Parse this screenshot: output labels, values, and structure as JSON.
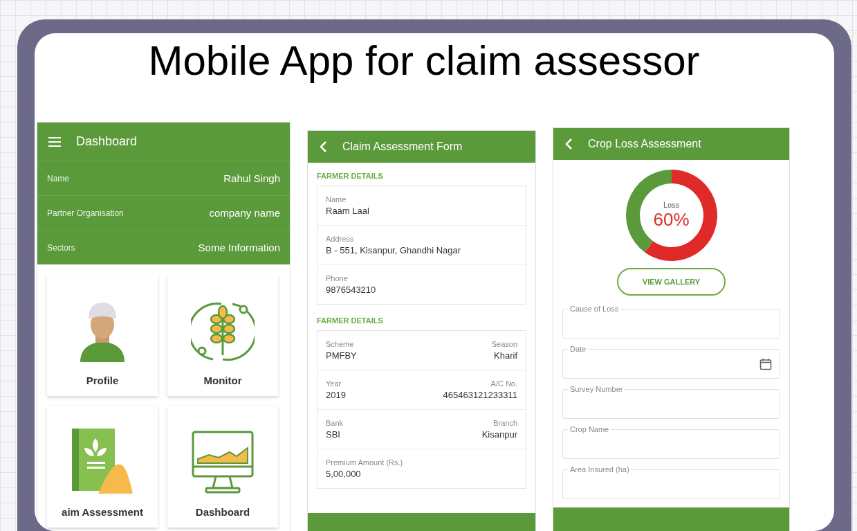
{
  "slide": {
    "title": "Mobile App for claim assessor"
  },
  "screens": [
    {
      "kind": "dashboard",
      "header": {
        "title": "Dashboard"
      },
      "info": [
        {
          "label": "Name",
          "value": "Rahul Singh"
        },
        {
          "label": "Partner Organisation",
          "value": "company  name"
        },
        {
          "label": "Sectors",
          "value": "Some Information"
        }
      ],
      "tiles": [
        {
          "kind": "profile",
          "label": "Profile"
        },
        {
          "kind": "monitor",
          "label": "Monitor"
        },
        {
          "kind": "claim",
          "label": "aim Assessment"
        },
        {
          "kind": "dashboard",
          "label": "Dashboard"
        }
      ]
    },
    {
      "kind": "claim_form",
      "header": {
        "title": "Claim Assessment Form"
      },
      "sections": [
        {
          "title": "FARMER DETAILS",
          "rows": [
            {
              "fields": [
                {
                  "label": "Name",
                  "value": "Raam Laal"
                }
              ]
            },
            {
              "fields": [
                {
                  "label": "Address",
                  "value": "B - 551, Kisanpur, Ghandhi Nagar"
                }
              ]
            },
            {
              "fields": [
                {
                  "label": "Phone",
                  "value": "9876543210"
                }
              ]
            }
          ]
        },
        {
          "title": "FARMER DETAILS",
          "rows": [
            {
              "fields": [
                {
                  "label": "Scheme",
                  "value": "PMFBY"
                },
                {
                  "label": "Season",
                  "value": "Kharif"
                }
              ]
            },
            {
              "fields": [
                {
                  "label": "Year",
                  "value": "2019"
                },
                {
                  "label": "A/C No.",
                  "value": "465463121233311"
                }
              ]
            },
            {
              "fields": [
                {
                  "label": "Bank",
                  "value": "SBI"
                },
                {
                  "label": "Branch",
                  "value": "Kisanpur"
                }
              ]
            },
            {
              "fields": [
                {
                  "label": "Premium Amount (Rs.)",
                  "value": "5,00,000"
                }
              ]
            }
          ]
        }
      ]
    },
    {
      "kind": "crop_loss",
      "header": {
        "title": "Crop Loss Assessment"
      },
      "loss": {
        "label": "Loss",
        "value": "60%",
        "chart_data": {
          "type": "donut",
          "values": [
            60,
            40
          ]
        }
      },
      "gallery_button": "VIEW GALLERY",
      "fields": [
        {
          "kind": "text",
          "label": "Cause of Loss"
        },
        {
          "kind": "date",
          "label": "Date"
        },
        {
          "kind": "text",
          "label": "Survey Number"
        },
        {
          "kind": "text",
          "label": "Crop Name"
        },
        {
          "kind": "text",
          "label": "Area Insured (ha)"
        }
      ]
    }
  ]
}
